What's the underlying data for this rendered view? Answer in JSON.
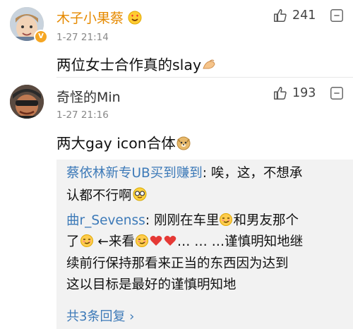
{
  "comments": [
    {
      "username": "木子小果蔡",
      "time": "1-27 21:14",
      "text": "两位女士合作真的slay",
      "likes": "241",
      "verified_badge": "V",
      "name_emoji": "heart-eyes-emoji",
      "text_emoji": "pinching-hand-emoji",
      "name_color": "#e68a00"
    },
    {
      "username": "奇怪的Min",
      "time": "1-27 21:16",
      "text": "两大gay icon合体",
      "likes": "193",
      "text_emoji": "doge-emoji",
      "name_color": "#333333",
      "replies": [
        {
          "author": "蔡依林新专UB买到赚到",
          "lines": [
            ": 唉，这，不想承",
            "认都不行啊"
          ],
          "end_emoji": "nerd-glasses-emoji"
        },
        {
          "author": "曲r_Sevenss",
          "lines": [
            ": 刚刚在车里",
            "和男友那个",
            "了",
            " ←来看",
            "… … …谨慎明知地继",
            "续前行保持那看来正当的东西因为达到",
            "这以目标是最好的谨慎明知地"
          ],
          "emojis": [
            "smirk-emoji",
            "red-heart-emoji"
          ]
        }
      ],
      "more_replies": "共3条回复 ›"
    }
  ],
  "colors": {
    "link_blue": "#3d7ab8",
    "reply_bg": "#f2f2f2",
    "time_gray": "#888888"
  }
}
